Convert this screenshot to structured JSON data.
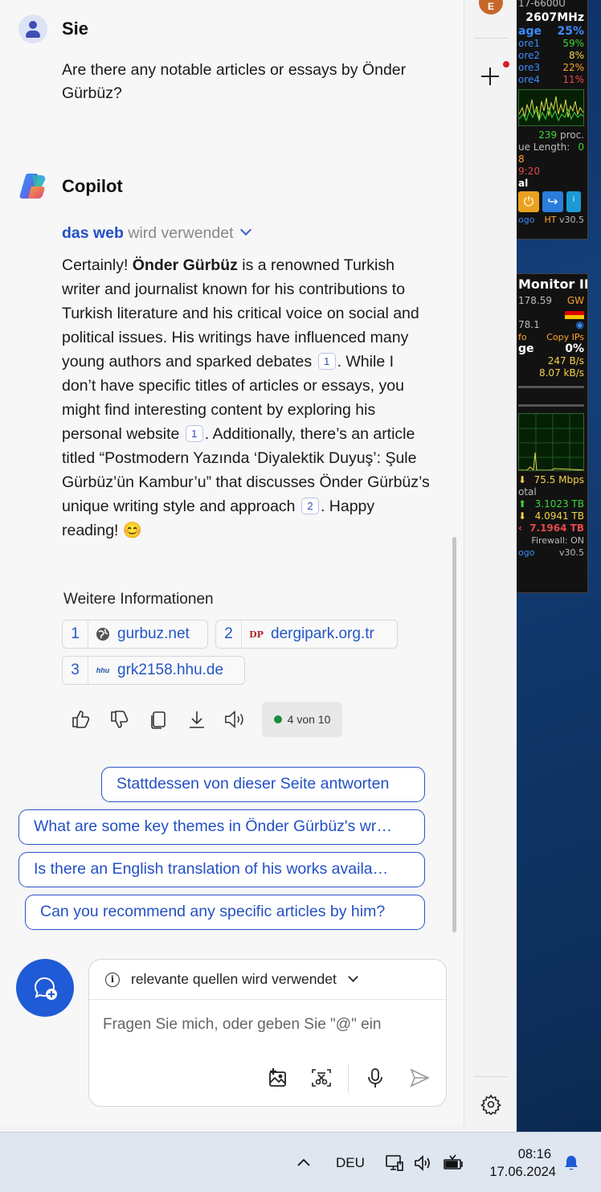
{
  "user": {
    "name": "Sie",
    "message": "Are there any notable articles or essays by Önder Gürbüz?"
  },
  "copilot": {
    "name": "Copilot",
    "source_strong": "das web",
    "source_rest": " wird verwendet",
    "answer": {
      "p1": "Certainly! ",
      "bold": "Önder Gürbüz",
      "p2": " is a renowned Turkish writer and journalist known for his contributions to Turkish literature and his critical voice on social and political issues. His writings have influenced many young authors and sparked debates ",
      "c1": "1",
      "p3": ". While I don’t have specific titles of articles or essays, you might find interesting content by exploring his personal website ",
      "c2": "1",
      "p4": ". Additionally, there’s an article titled “Postmodern Yazında ‘Diyalektik Duyuş’: Şule Gürbüz’ün Kambur’u” that discusses Önder Gürbüz’s unique writing style and approach ",
      "c3": "2",
      "p5": ". Happy reading! 😊"
    },
    "more_info_title": "Weitere Informationen",
    "sources": [
      {
        "num": "1",
        "site": "gurbuz.net",
        "icon": "globe-icon"
      },
      {
        "num": "2",
        "site": "dergipark.org.tr",
        "icon": "dergipark-logo",
        "logo_text": "DP"
      },
      {
        "num": "3",
        "site": "grk2158.hhu.de",
        "icon": "hhu-logo",
        "logo_text": "hhu"
      }
    ],
    "counter": "4 von 10"
  },
  "suggestions": [
    "Stattdessen von dieser Seite antworten",
    "What are some key themes in Önder Gürbüz's wr…",
    "Is there an English translation of his works availa…",
    "Can you recommend any specific articles by him?"
  ],
  "composer": {
    "mode": "relevante quellen wird verwendet",
    "placeholder": "Fragen Sie mich, oder geben Sie \"@\" ein"
  },
  "rail": {
    "avatar_letter": "E"
  },
  "gadget1": {
    "top": "17-6600U",
    "freq": "2607MHz",
    "usage_label": "age",
    "usage": "25%",
    "cores": [
      {
        "label": "ore1",
        "value": "59%"
      },
      {
        "label": "ore2",
        "value": "8%"
      },
      {
        "label": "ore3",
        "value": "22%"
      },
      {
        "label": "ore4",
        "value": "11%"
      }
    ],
    "proc_value": "239",
    "proc_label": "proc.",
    "queue_label": "ue Length:",
    "queue_value": "0",
    "line3": "8",
    "line4": "9:20",
    "line5": "al",
    "footer_left": "ogo",
    "footer_ht": "HT",
    "footer_ver": "v30.5"
  },
  "gadget2": {
    "title": "Monitor II",
    "ip1": "178.59",
    "gw": "GW",
    "ip2": "78.1",
    "info": "fo",
    "copy": "Copy IPs",
    "ge": "ge",
    "pct": "0%",
    "up": "247 B/s",
    "down": "8.07 kB/s",
    "speed": "75.5 Mbps",
    "total_label": "otal",
    "tb1": "3.1023 TB",
    "tb2": "4.0941 TB",
    "tb3": "7.1964 TB",
    "firewall": "Firewall: ON",
    "footer_left": "ogo",
    "footer_ver": "v30.5"
  },
  "taskbar": {
    "lang": "DEU",
    "time": "08:16",
    "date": "17.06.2024"
  },
  "colors": {
    "accent": "#2350c5",
    "newchat": "#1f5bd6",
    "counter_dot": "#1e8a3d"
  }
}
